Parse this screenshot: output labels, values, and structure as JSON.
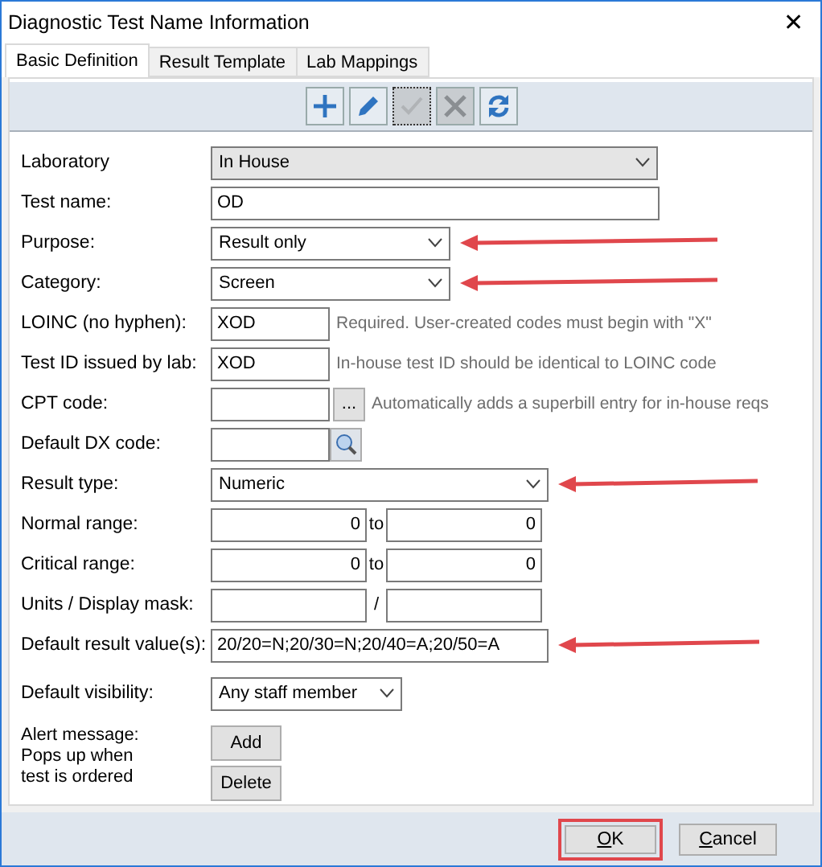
{
  "window": {
    "title": "Diagnostic Test Name Information",
    "close": "✕"
  },
  "tabs": [
    {
      "label": "Basic Definition",
      "selected": true
    },
    {
      "label": "Result Template",
      "selected": false
    },
    {
      "label": "Lab Mappings",
      "selected": false
    }
  ],
  "toolbar": [
    {
      "kind": "add",
      "disabled": false,
      "focused": false
    },
    {
      "kind": "edit",
      "disabled": false,
      "focused": false
    },
    {
      "kind": "save",
      "disabled": true,
      "focused": true
    },
    {
      "kind": "delete",
      "disabled": true,
      "focused": false
    },
    {
      "kind": "refresh",
      "disabled": false,
      "focused": false
    }
  ],
  "fields": [
    {
      "label": "Laboratory",
      "kind": "combo",
      "value": "In House",
      "highlighted": false
    },
    {
      "label": "Test name:",
      "kind": "text",
      "value": "OD",
      "highlighted": false
    },
    {
      "label": "Purpose:",
      "kind": "dropdown",
      "value": "Result only",
      "highlighted": true
    },
    {
      "label": "Category:",
      "kind": "dropdown",
      "value": "Screen",
      "highlighted": true
    },
    {
      "label": "LOINC (no hyphen):",
      "kind": "hinted",
      "value": "XOD",
      "hint": "Required. User-created codes must begin with \"X\"",
      "highlighted": false
    },
    {
      "label": "Test ID issued by lab:",
      "kind": "hinted",
      "value": "XOD",
      "hint": "In-house test ID should be identical to LOINC code",
      "highlighted": false
    },
    {
      "label": "CPT code:",
      "kind": "browse",
      "browse": "...",
      "hint": "Automatically adds a superbill entry for in-house reqs",
      "highlighted": false
    },
    {
      "label": "Default DX code:",
      "kind": "lookup",
      "highlighted": false
    },
    {
      "label": "Result type:",
      "kind": "dropdown",
      "value": "Numeric",
      "highlighted": true
    },
    {
      "label": "Normal range:",
      "kind": "range",
      "from": "0",
      "separator": "to",
      "to": "0",
      "highlighted": false
    },
    {
      "label": "Critical range:",
      "kind": "range",
      "from": "0",
      "separator": "to",
      "to": "0",
      "highlighted": false
    },
    {
      "label": "Units / Display mask:",
      "kind": "units",
      "separator": "/",
      "highlighted": false
    },
    {
      "label": "Default result value(s):",
      "kind": "text",
      "value": "20/20=N;20/30=N;20/40=A;20/50=A",
      "highlighted": true
    },
    {
      "label": "Default visibility:",
      "kind": "dropdown",
      "value": "Any staff member",
      "highlighted": false
    }
  ],
  "alert": {
    "label": "Alert message:\nPops up when\ntest is ordered",
    "buttons": [
      "Add",
      "Delete"
    ]
  },
  "footer": [
    {
      "label": "OK",
      "highlighted": true
    },
    {
      "label": "Cancel",
      "highlighted": false
    }
  ]
}
